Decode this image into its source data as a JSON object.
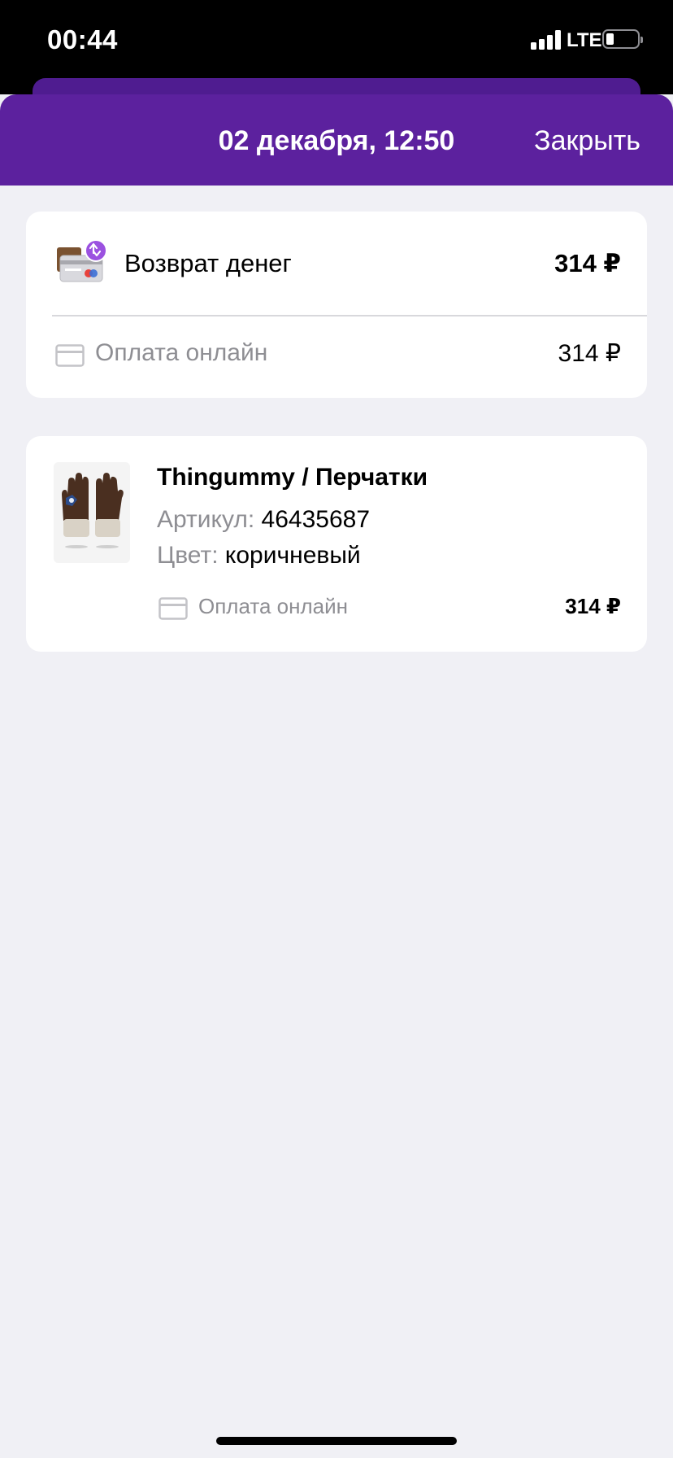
{
  "status_bar": {
    "time": "00:44",
    "network": "LTE",
    "battery_level": 0.2
  },
  "header": {
    "title": "02 декабря, 12:50",
    "close_label": "Закрыть",
    "color": "#5c219e"
  },
  "refund_card": {
    "icon": "refund-card-icon",
    "label": "Возврат денег",
    "amount": "314 ₽",
    "payment": {
      "icon": "credit-card-icon",
      "label": "Оплата онлайн",
      "amount": "314 ₽"
    }
  },
  "product_card": {
    "image": "gloves-product-image",
    "title": "Thingummy / Перчатки",
    "sku_label": "Артикул:",
    "sku_value": "46435687",
    "color_label": "Цвет:",
    "color_value": "коричневый",
    "payment": {
      "icon": "credit-card-icon",
      "label": "Оплата онлайн",
      "amount": "314 ₽"
    }
  }
}
